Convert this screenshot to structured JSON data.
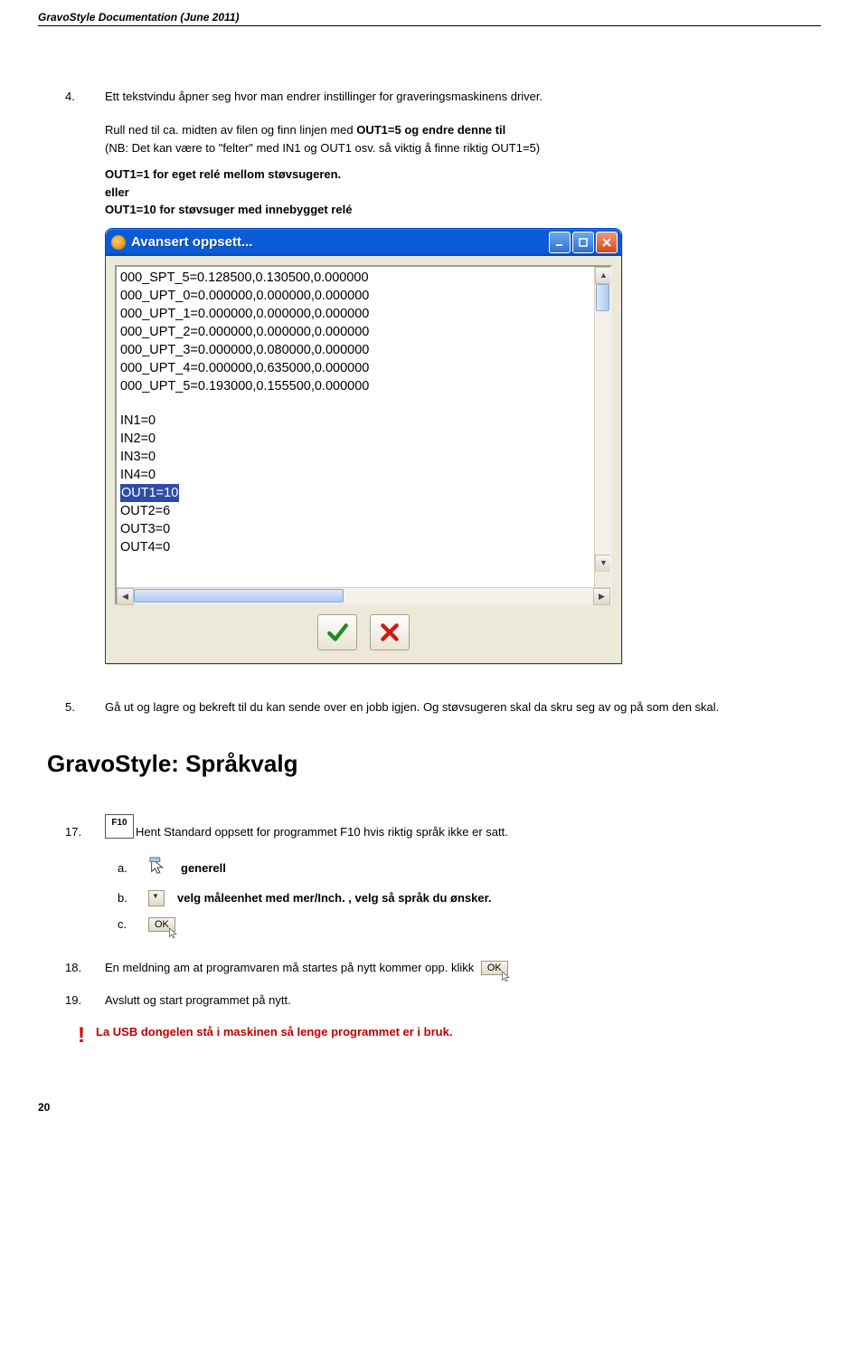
{
  "doc_title": "GravoStyle Documentation (June 2011)",
  "step4_num": "4.",
  "step4_text": "Ett tekstvindu åpner seg hvor man endrer instillinger for graveringsmaskinens driver.",
  "rull_line1": "Rull ned til ca. midten av filen og finn linjen med ",
  "rull_bold1": "OUT1=5 og endre denne til",
  "rull_line2": "(NB: Det kan være to \"felter\" med IN1 og OUT1 osv. så viktig å finne riktig OUT1=5)",
  "out_line_a": "OUT1=1 for eget relé mellom støvsugeren.",
  "out_eller": "eller",
  "out_line_b": "OUT1=10 for støvsuger med innebygget relé",
  "window_title": "Avansert oppsett...",
  "list_lines_top": [
    "000_SPT_5=0.128500,0.130500,0.000000",
    "000_UPT_0=0.000000,0.000000,0.000000",
    "000_UPT_1=0.000000,0.000000,0.000000",
    "000_UPT_2=0.000000,0.000000,0.000000",
    "000_UPT_3=0.000000,0.080000,0.000000",
    "000_UPT_4=0.000000,0.635000,0.000000",
    "000_UPT_5=0.193000,0.155500,0.000000"
  ],
  "list_lines_bottom": [
    "IN1=0",
    "IN2=0",
    "IN3=0",
    "IN4=0"
  ],
  "list_selected": "OUT1=10",
  "list_lines_after": [
    "OUT2=6",
    "OUT3=0",
    "OUT4=0"
  ],
  "step5_num": "5.",
  "step5_text": "Gå ut og lagre og bekreft til du kan sende over en jobb igjen. Og støvsugeren skal da skru seg av og på som den skal.",
  "section_title": "GravoStyle: Språkvalg",
  "f10_label": "F10",
  "step17_num": "17.",
  "step17_text": "Hent Standard oppsett for programmet F10 hvis riktig språk ikke er satt.",
  "sub_a_lt": "a.",
  "sub_a_text": "generell",
  "sub_b_lt": "b.",
  "sub_b_text": "velg måleenhet med mer/Inch. , velg så språk du ønsker.",
  "sub_c_lt": "c.",
  "ok_label": "OK",
  "step18_num": "18.",
  "step18_text": "En meldning am at programvaren må startes på nytt kommer opp. klikk",
  "step19_num": "19.",
  "step19_text": "Avslutt og start programmet på nytt.",
  "warn_text": "La USB dongelen stå i maskinen så lenge programmet er i bruk.",
  "page_num": "20"
}
